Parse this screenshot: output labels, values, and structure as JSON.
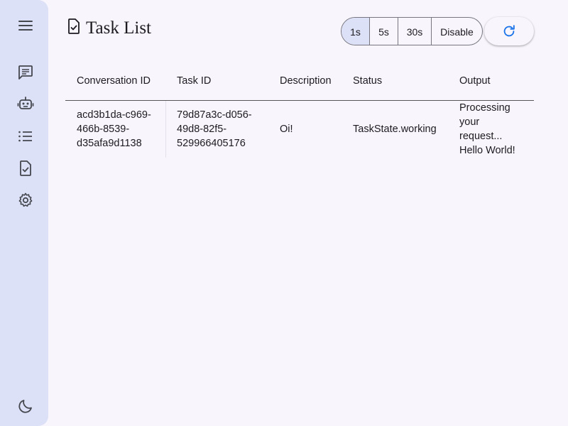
{
  "sidebar": {
    "items": [
      {
        "name": "menu-icon"
      },
      {
        "name": "conversations-icon"
      },
      {
        "name": "agents-icon"
      },
      {
        "name": "events-icon"
      },
      {
        "name": "tasks-icon"
      },
      {
        "name": "settings-icon"
      }
    ],
    "theme_toggle": "dark-mode-icon"
  },
  "page": {
    "title": "Task List"
  },
  "refresh_interval": {
    "options": [
      "1s",
      "5s",
      "30s",
      "Disable"
    ],
    "selected": "1s"
  },
  "colors": {
    "sidebar_bg": "#dde1f7",
    "page_bg": "#f8f6fc",
    "accent": "#1a73e8",
    "selected_segment": "#dde1f7"
  },
  "table": {
    "columns": [
      "Conversation ID",
      "Task ID",
      "Description",
      "Status",
      "Output"
    ],
    "rows": [
      {
        "conversation_id": "acd3b1da-c969-466b-8539-d35afa9d1138",
        "conversation_id_lines": [
          "acd3b1da-c969-",
          "466b-8539-",
          "d35afa9d1138"
        ],
        "task_id": "79d87a3c-d056-49d8-82f5-529966405176",
        "task_id_lines": [
          "79d87a3c-d056-",
          "49d8-82f5-",
          "529966405176"
        ],
        "description": "Oi!",
        "status": "TaskState.working",
        "output": "Processing your request... Hello World!",
        "output_lines": [
          "Processing",
          "your",
          "request...",
          "Hello World!"
        ]
      }
    ]
  }
}
